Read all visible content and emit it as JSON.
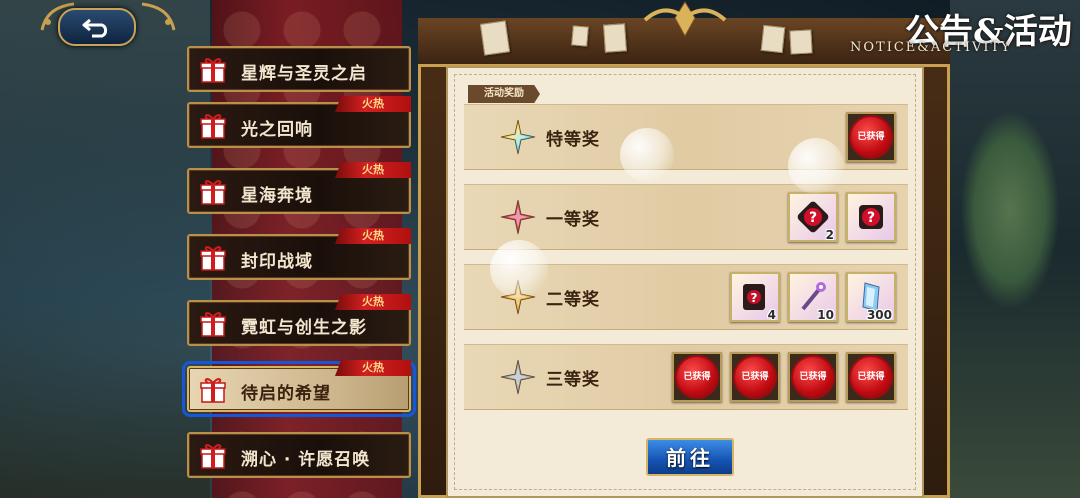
{
  "header": {
    "title_cn": "公告&活动",
    "title_en": "NOTICE&ACTIVITY",
    "back_icon": "back-arrow-icon"
  },
  "sidebar": {
    "items": [
      {
        "label": "星辉与圣灵之启",
        "hot": ""
      },
      {
        "label": "光之回响",
        "hot": "火热"
      },
      {
        "label": "星海奔境",
        "hot": "火热"
      },
      {
        "label": "封印战域",
        "hot": "火热"
      },
      {
        "label": "霓虹与创生之影",
        "hot": "火热"
      },
      {
        "label": "待启的希望",
        "hot": "火热",
        "selected": true
      },
      {
        "label": "溯心 · 许愿召唤",
        "hot": ""
      }
    ]
  },
  "main": {
    "section_tag": "活动奖励",
    "prizes": [
      {
        "label": "特等奖",
        "star_color": "rainbow",
        "rewards": [
          {
            "type": "seal",
            "text": "已获得"
          }
        ]
      },
      {
        "label": "一等奖",
        "star_color": "#d23a5a",
        "rewards": [
          {
            "type": "mystery",
            "count": "2"
          },
          {
            "type": "mystery-dark",
            "count": ""
          }
        ]
      },
      {
        "label": "二等奖",
        "star_color": "#e3a92a",
        "rewards": [
          {
            "type": "scroll",
            "count": "4"
          },
          {
            "type": "staff",
            "count": "10"
          },
          {
            "type": "crystal",
            "count": "300"
          }
        ]
      },
      {
        "label": "三等奖",
        "star_color": "#9aa2aa",
        "rewards": [
          {
            "type": "seal",
            "text": "已获得"
          },
          {
            "type": "seal",
            "text": "已获得"
          },
          {
            "type": "seal",
            "text": "已获得"
          },
          {
            "type": "seal",
            "text": "已获得"
          }
        ]
      }
    ],
    "go_button": "前往"
  },
  "colors": {
    "accent_gold": "#c9a050",
    "hot_red": "#d42020",
    "go_blue": "#1553b3",
    "selection_blue": "#1856d8"
  }
}
